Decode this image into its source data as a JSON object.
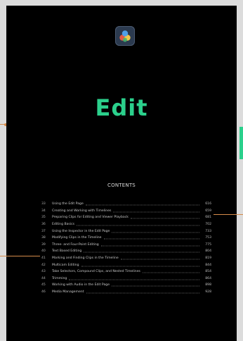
{
  "page": {
    "title": "Edit"
  },
  "contents": {
    "heading": "CONTENTS",
    "entries": [
      {
        "num": "33",
        "title": "Using the Edit Page",
        "page": "616"
      },
      {
        "num": "34",
        "title": "Creating and Working with Timelines",
        "page": "659"
      },
      {
        "num": "35",
        "title": "Preparing Clips for Editing and Viewer Playback",
        "page": "681"
      },
      {
        "num": "36",
        "title": "Editing Basics",
        "page": "702"
      },
      {
        "num": "37",
        "title": "Using the Inspector in the Edit Page",
        "page": "733"
      },
      {
        "num": "38",
        "title": "Modifying Clips in the Timeline",
        "page": "753"
      },
      {
        "num": "39",
        "title": "Three- and Four-Point Editing",
        "page": "775"
      },
      {
        "num": "40",
        "title": "Text Based Editing",
        "page": "804"
      },
      {
        "num": "41",
        "title": "Marking and Finding Clips in the Timeline",
        "page": "819"
      },
      {
        "num": "42",
        "title": "Multicam Editing",
        "page": "844"
      },
      {
        "num": "43",
        "title": "Take Selectors, Compound Clips, and Nested Timelines",
        "page": "854"
      },
      {
        "num": "44",
        "title": "Trimming",
        "page": "864"
      },
      {
        "num": "45",
        "title": "Working with Audio in the Edit Page",
        "page": "898"
      },
      {
        "num": "46",
        "title": "Media Management",
        "page": "928"
      }
    ]
  },
  "colors": {
    "accent_green": "#2bd08c",
    "marker_orange": "#d58b4a",
    "page_background": "#000000"
  },
  "icons": {
    "logo": "davinci-resolve-logo-icon"
  }
}
